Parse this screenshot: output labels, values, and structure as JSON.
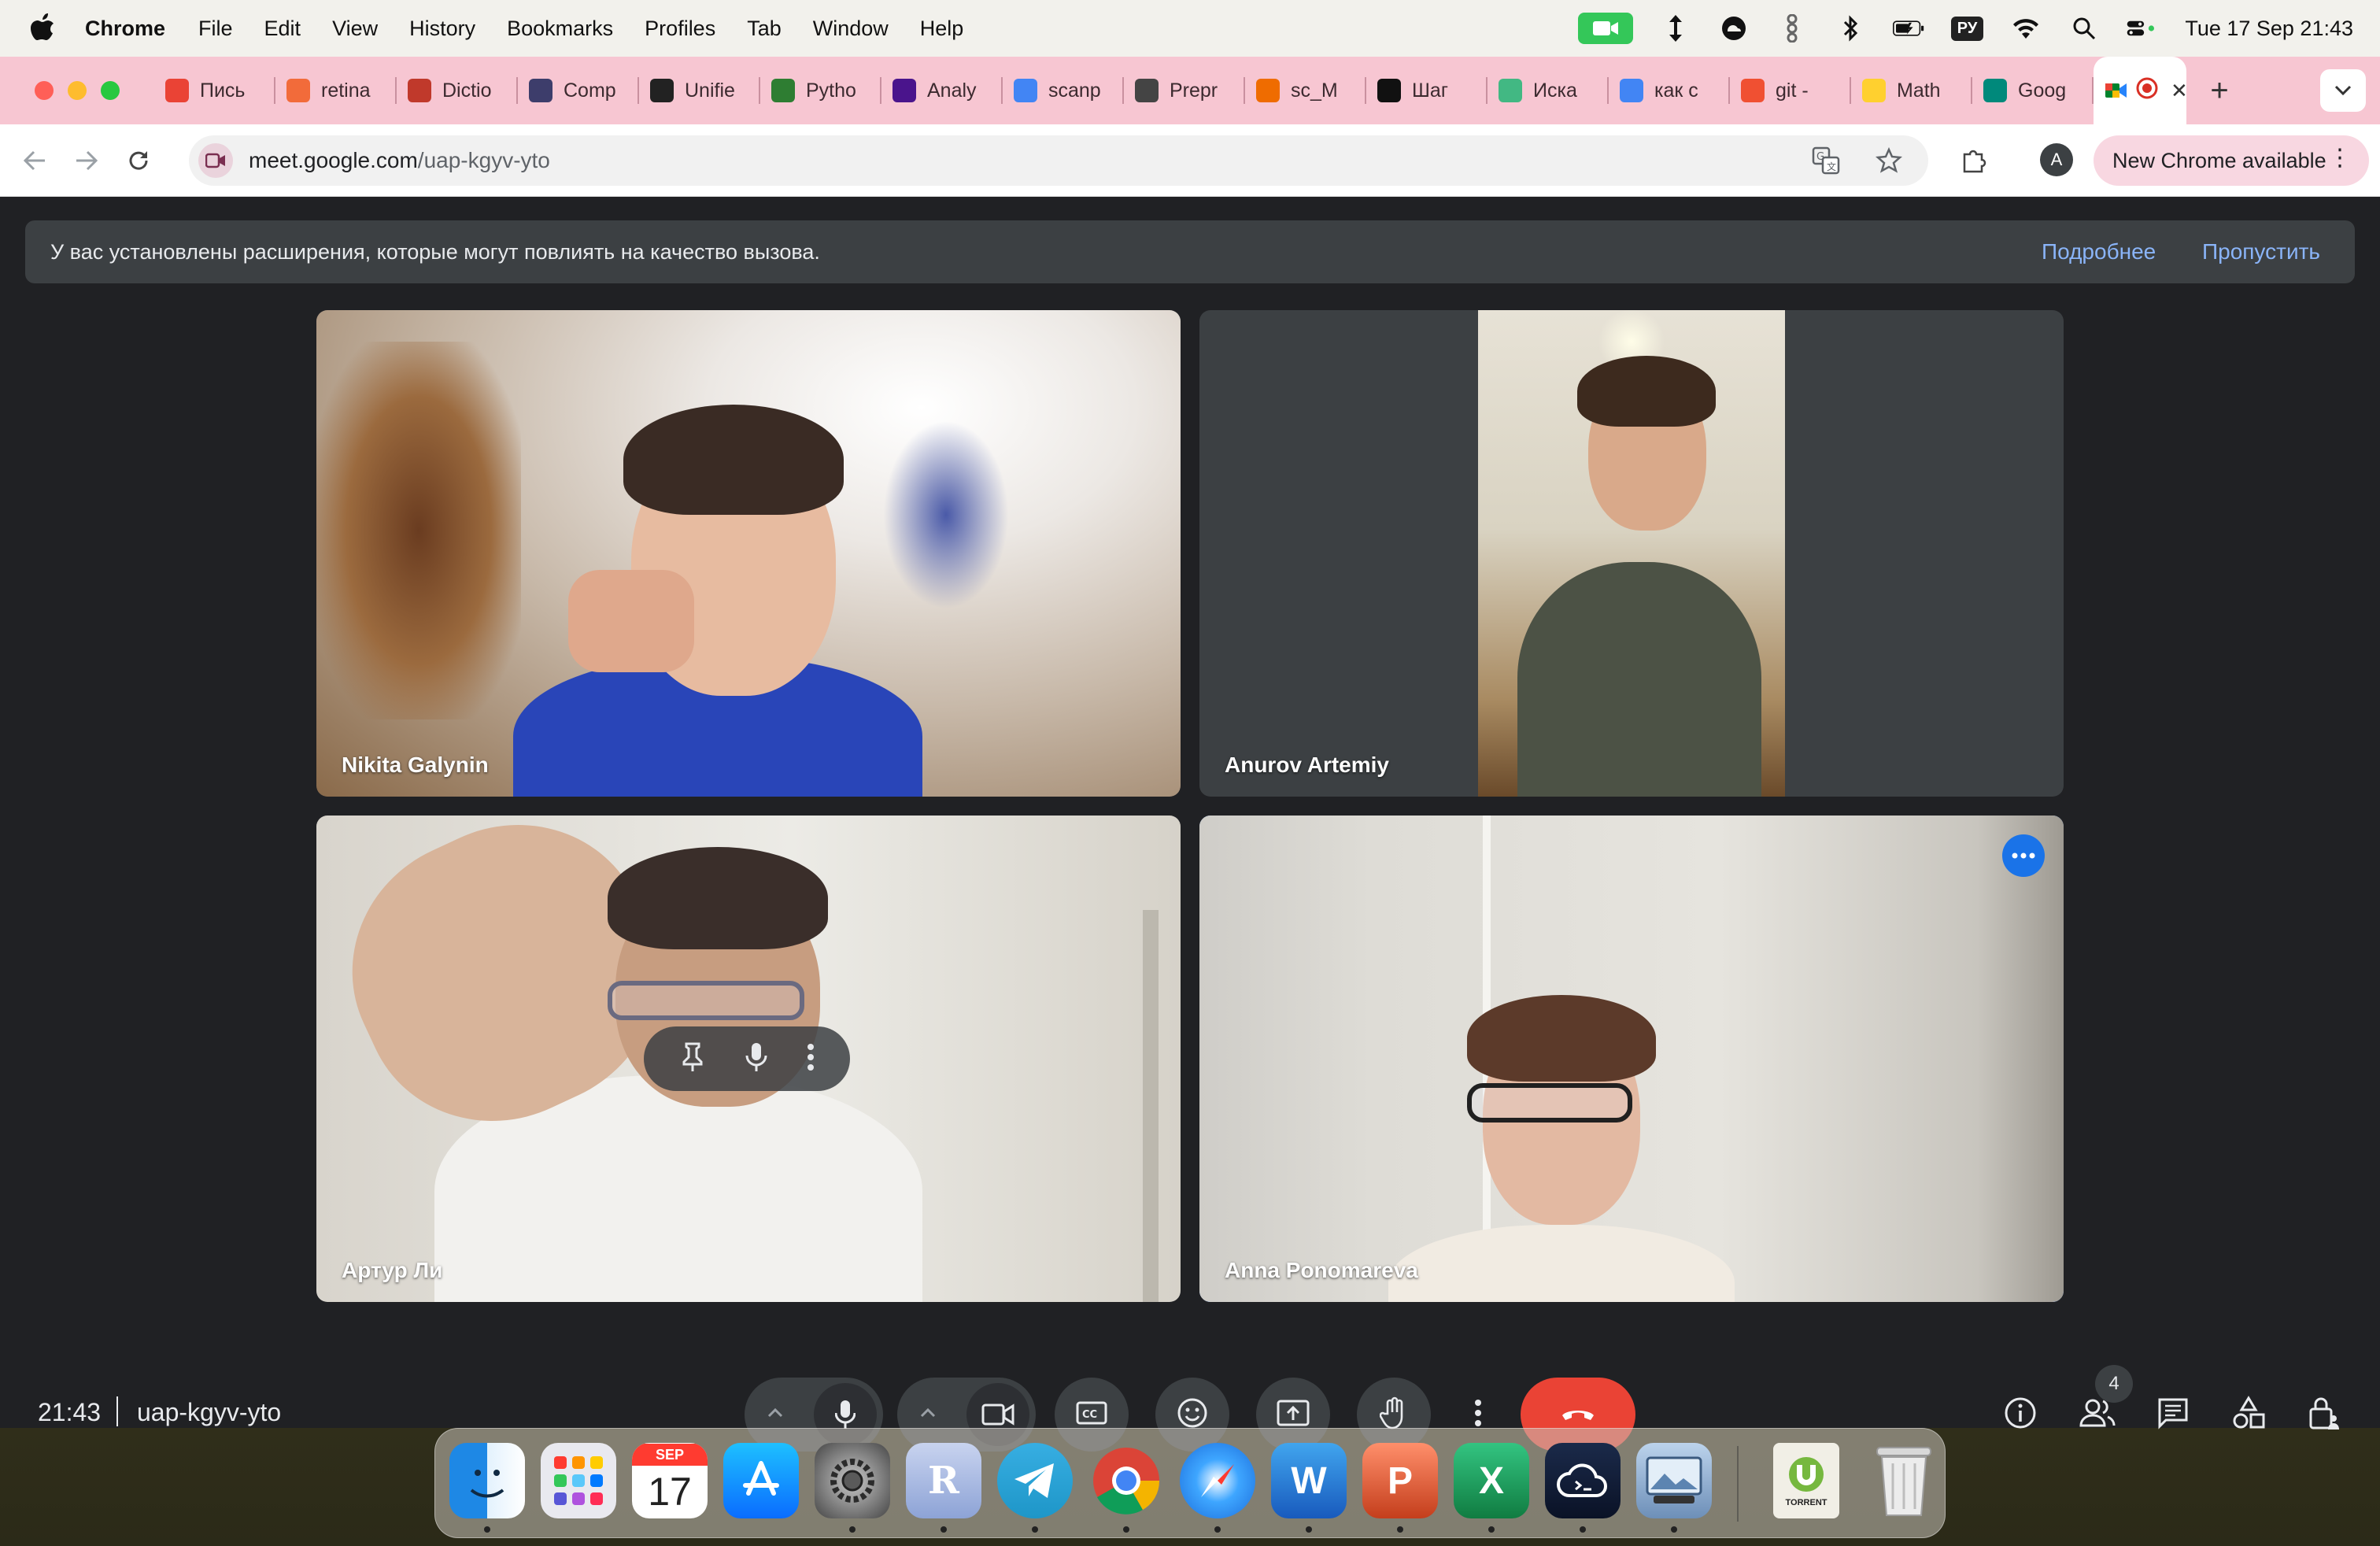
{
  "menubar": {
    "app_name": "Chrome",
    "items": [
      "File",
      "Edit",
      "View",
      "History",
      "Bookmarks",
      "Profiles",
      "Tab",
      "Window",
      "Help"
    ],
    "keyboard_layout": "РУ",
    "clock": "Tue 17 Sep  21:43"
  },
  "tabs": [
    {
      "label": "Пись",
      "icon": "gmail-icon",
      "color": "#ea4335"
    },
    {
      "label": "retina",
      "icon": "spinner-icon",
      "color": "#f26b3a"
    },
    {
      "label": "Dictio",
      "icon": "dictionary-icon",
      "color": "#c0392b"
    },
    {
      "label": "Comp",
      "icon": "comp-icon",
      "color": "#3d3d6b"
    },
    {
      "label": "Unifie",
      "icon": "unified-icon",
      "color": "#222222"
    },
    {
      "label": "Pytho",
      "icon": "glasses-icon",
      "color": "#2e7d32"
    },
    {
      "label": "Analy",
      "icon": "analysis-icon",
      "color": "#4a148c"
    },
    {
      "label": "scanp",
      "icon": "google-icon",
      "color": "#4285f4"
    },
    {
      "label": "Prepr",
      "icon": "paper-icon",
      "color": "#444444"
    },
    {
      "label": "sc_M",
      "icon": "notebook-icon",
      "color": "#ef6c00"
    },
    {
      "label": "Шаг",
      "icon": "openai-icon",
      "color": "#111111"
    },
    {
      "label": "Иска",
      "icon": "vue-icon",
      "color": "#42b883"
    },
    {
      "label": "как с",
      "icon": "google-icon",
      "color": "#4285f4"
    },
    {
      "label": "git -",
      "icon": "git-icon",
      "color": "#f05032"
    },
    {
      "label": "Math",
      "icon": "miro-icon",
      "color": "#ffd02f"
    },
    {
      "label": "Goog",
      "icon": "meet-icon",
      "color": "#00897b"
    }
  ],
  "active_tab": {
    "icon": "meet-recording-icon",
    "close": "✕"
  },
  "toolbar": {
    "url_host": "meet.google.com",
    "url_path": "/uap-kgyv-yto",
    "profile_initial": "A",
    "update_label": "New Chrome available"
  },
  "banner": {
    "message": "У вас установлены расширения, которые могут повлиять на качество вызова.",
    "learn_more": "Подробнее",
    "dismiss": "Пропустить"
  },
  "participants": [
    {
      "name": "Nikita Galynin"
    },
    {
      "name": "Anurov Artemiy"
    },
    {
      "name": "Артур Ли"
    },
    {
      "name": "Anna Ponomareva"
    }
  ],
  "bottombar": {
    "time": "21:43",
    "meeting_code": "uap-kgyv-yto",
    "participant_count": "4",
    "end_call_color": "#ea4335"
  },
  "dock": {
    "calendar_month": "SEP",
    "calendar_day": "17",
    "r_label": "R",
    "word_label": "W",
    "ppt_label": "P",
    "excel_label": "X",
    "torrent_label": "TORRENT"
  }
}
